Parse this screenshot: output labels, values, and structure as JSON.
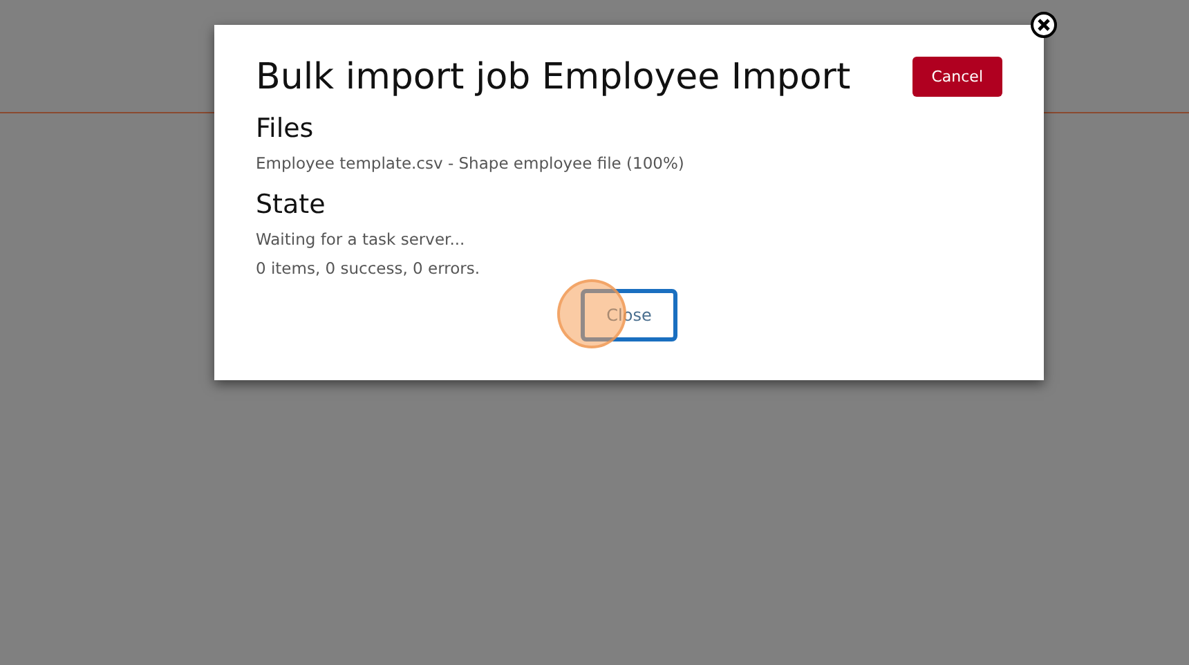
{
  "dialog": {
    "title": "Bulk import job Employee Import",
    "cancel_button": "Cancel",
    "sections": [
      {
        "heading": "Files",
        "lines": [
          "Employee template.csv - Shape employee file (100%)"
        ]
      },
      {
        "heading": "State",
        "lines": [
          "Waiting for a task server...",
          "0 items, 0 success, 0 errors."
        ]
      }
    ],
    "close_button": {
      "label": "Close",
      "focused": true
    }
  }
}
